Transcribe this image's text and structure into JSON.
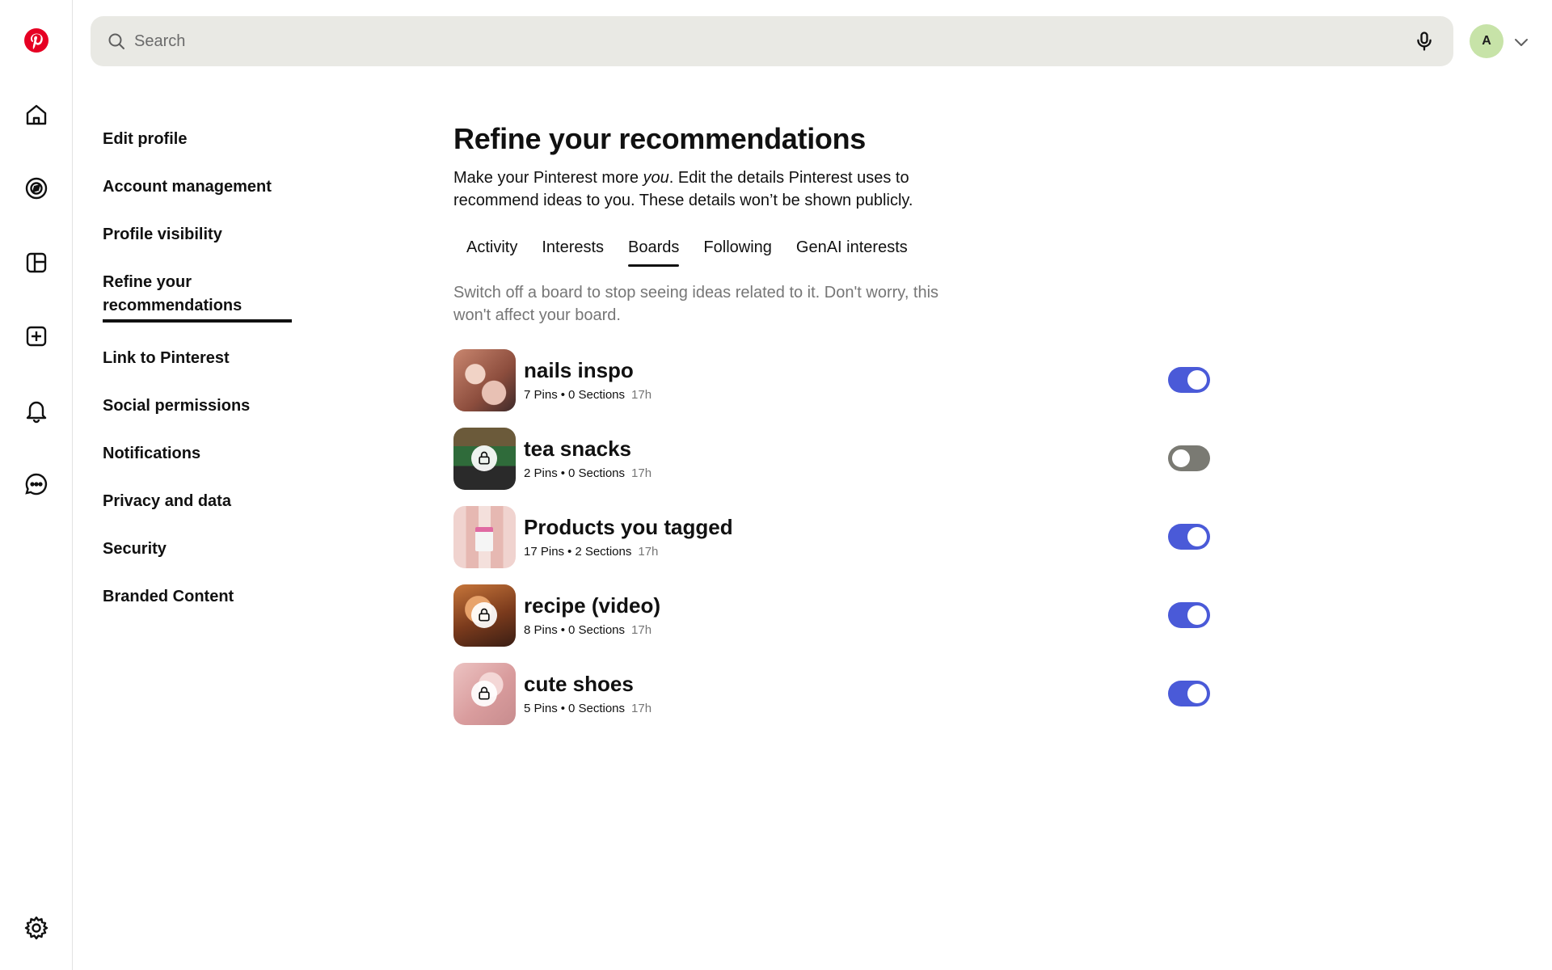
{
  "header": {
    "search_placeholder": "Search",
    "avatar_initial": "A"
  },
  "rail": {
    "items": [
      "pinterest-logo",
      "home-icon",
      "explore-icon",
      "boards-icon",
      "create-icon",
      "notifications-icon",
      "messages-icon",
      "settings-icon"
    ]
  },
  "settings_nav": {
    "items": [
      {
        "label": "Edit profile"
      },
      {
        "label": "Account management"
      },
      {
        "label": "Profile visibility"
      },
      {
        "label": "Refine your recommendations"
      },
      {
        "label": "Link to Pinterest"
      },
      {
        "label": "Social permissions"
      },
      {
        "label": "Notifications"
      },
      {
        "label": "Privacy and data"
      },
      {
        "label": "Security"
      },
      {
        "label": "Branded Content"
      }
    ],
    "active_index": 3
  },
  "main": {
    "title": "Refine your recommendations",
    "subtitle_before": "Make your Pinterest more ",
    "subtitle_em": "you",
    "subtitle_after": ". Edit the details Pinterest uses to recommend ideas to you. These details won’t be shown publicly.",
    "tabs": [
      {
        "label": "Activity"
      },
      {
        "label": "Interests"
      },
      {
        "label": "Boards"
      },
      {
        "label": "Following"
      },
      {
        "label": "GenAI interests"
      }
    ],
    "active_tab": "Boards",
    "hint": "Switch off a board to stop seeing ideas related to it. Don't worry, this won't affect your board.",
    "boards": [
      {
        "name": "nails inspo",
        "pins": "7 Pins",
        "sections": "0 Sections",
        "time": "17h",
        "enabled": true,
        "secret": false
      },
      {
        "name": "tea snacks",
        "pins": "2 Pins",
        "sections": "0 Sections",
        "time": "17h",
        "enabled": false,
        "secret": true
      },
      {
        "name": "Products you tagged",
        "pins": "17 Pins",
        "sections": "2 Sections",
        "time": "17h",
        "enabled": true,
        "secret": false
      },
      {
        "name": "recipe (video)",
        "pins": "8 Pins",
        "sections": "0 Sections",
        "time": "17h",
        "enabled": true,
        "secret": true
      },
      {
        "name": "cute shoes",
        "pins": "5 Pins",
        "sections": "0 Sections",
        "time": "17h",
        "enabled": true,
        "secret": true
      }
    ],
    "meta_separator": "•"
  },
  "colors": {
    "brand": "#e60023",
    "toggle_on": "#4a5ad8",
    "toggle_off": "#7a7a73",
    "search_bg": "#e9e9e4",
    "avatar_bg": "#c7e3a8"
  }
}
